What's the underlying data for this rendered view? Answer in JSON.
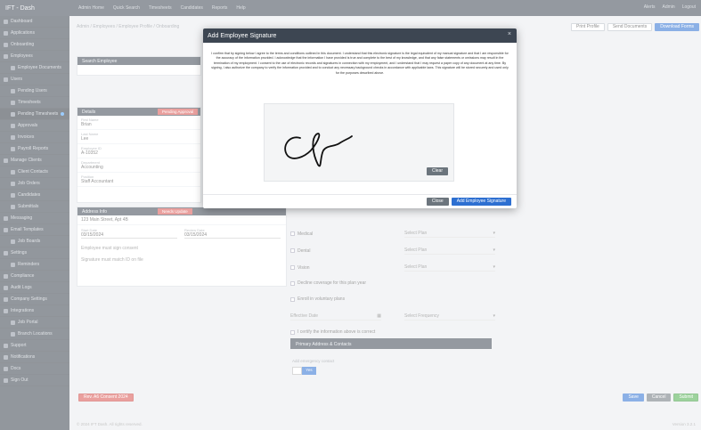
{
  "topbar": {
    "brand": "IFT - Dash",
    "links": [
      "Admin Home",
      "Quick Search",
      "Timesheets",
      "Candidates",
      "Reports",
      "Help"
    ],
    "right": [
      "Alerts",
      "Admin",
      "Logout"
    ]
  },
  "sidebar": {
    "items": [
      {
        "label": "Dashboard",
        "active": false,
        "sub": false
      },
      {
        "label": "Applications",
        "active": false,
        "sub": false
      },
      {
        "label": "Onboarding",
        "active": false,
        "sub": false
      },
      {
        "label": "Employees",
        "active": false,
        "sub": false
      },
      {
        "label": "Employee Documents",
        "active": false,
        "sub": true
      },
      {
        "label": "Users",
        "active": false,
        "sub": false
      },
      {
        "label": "Pending Users",
        "active": false,
        "sub": true
      },
      {
        "label": "Timesheets",
        "active": false,
        "sub": true
      },
      {
        "label": "Pending Timesheets",
        "active": true,
        "sub": true,
        "dot": true
      },
      {
        "label": "Approvals",
        "active": false,
        "sub": true
      },
      {
        "label": "Invoices",
        "active": false,
        "sub": true
      },
      {
        "label": "Payroll Reports",
        "active": false,
        "sub": true
      },
      {
        "label": "Manage Clients",
        "active": false,
        "sub": false
      },
      {
        "label": "Client Contacts",
        "active": false,
        "sub": true
      },
      {
        "label": "Job Orders",
        "active": false,
        "sub": true
      },
      {
        "label": "Candidates",
        "active": false,
        "sub": true
      },
      {
        "label": "Submittals",
        "active": false,
        "sub": true
      },
      {
        "label": "Messaging",
        "active": false,
        "sub": false
      },
      {
        "label": "Email Templates",
        "active": false,
        "sub": false
      },
      {
        "label": "Job Boards",
        "active": false,
        "sub": true
      },
      {
        "label": "Settings",
        "active": false,
        "sub": false
      },
      {
        "label": "Reminders",
        "active": false,
        "sub": true
      },
      {
        "label": "Compliance",
        "active": false,
        "sub": false
      },
      {
        "label": "Audit Logs",
        "active": false,
        "sub": false
      },
      {
        "label": "Company Settings",
        "active": false,
        "sub": false
      },
      {
        "label": "Integrations",
        "active": false,
        "sub": false
      },
      {
        "label": "Job Portal",
        "active": false,
        "sub": true
      },
      {
        "label": "Branch Locations",
        "active": false,
        "sub": true
      },
      {
        "label": "Support",
        "active": false,
        "sub": false
      },
      {
        "label": "Notifications",
        "active": false,
        "sub": false
      },
      {
        "label": "Docs",
        "active": false,
        "sub": false
      },
      {
        "label": "Sign Out",
        "active": false,
        "sub": false
      }
    ]
  },
  "main": {
    "breadcrumb": "Admin / Employees / Employee Profile / Onboarding",
    "top_buttons": [
      "Print Profile",
      "Send Documents",
      "Download Forms"
    ],
    "left_panel": {
      "search_label": "Search Employee",
      "header": "Details",
      "tag": "Pending Approval",
      "fields": [
        {
          "label": "First Name",
          "value": "Brian"
        },
        {
          "label": "Last Name",
          "value": "Lee"
        },
        {
          "label": "Employee ID",
          "value": "A-10352"
        },
        {
          "label": "Department",
          "value": "Accounting"
        },
        {
          "label": "Position",
          "value": "Staff Accountant"
        }
      ]
    },
    "address_panel": {
      "header": "Address Info",
      "tag": "Needs Update",
      "street": "123 Main Street, Apt 4B",
      "start_label": "Start Date",
      "start_date": "03/15/2024",
      "review_label": "Review Date",
      "review_date": "03/15/2024",
      "note1": "Employee must sign consent",
      "note2": "Signature must match ID on file"
    },
    "right_panel": {
      "header": "Benefits Enrollment",
      "rows": [
        {
          "check": "Medical",
          "select": "Select Plan"
        },
        {
          "check": "Dental",
          "select": "Select Plan"
        },
        {
          "check": "Vision",
          "select": "Select Plan"
        }
      ],
      "check4": "Decline coverage for this plan year",
      "check5": "Enroll in voluntary plans",
      "date_placeholder": "Effective Date",
      "select4": "Select Frequency",
      "check6": "I certify the information above is correct",
      "bottom_header": "Primary Address & Contacts",
      "bottom_label": "Add emergency contact",
      "bottom_select": "Yes"
    },
    "red_button": "Rev. A6 Consent 2024",
    "bottom_buttons": [
      "Save",
      "Cancel",
      "Submit"
    ],
    "footer": "© 2024 IFT Dash. All rights reserved.",
    "footer_right": "Version 3.2.1"
  },
  "modal": {
    "title": "Add Employee Signature",
    "close": "×",
    "consent_text": "I confirm that by signing below I agree to the terms and conditions outlined in this document. I understand that this electronic signature is the legal equivalent of my manual signature and that I am responsible for the accuracy of the information provided. I acknowledge that the information I have provided is true and complete to the best of my knowledge, and that any false statements or omissions may result in the termination of my employment. I consent to the use of electronic records and signatures in connection with my employment, and I understand that I may request a paper copy of any document at any time. By signing, I also authorize the company to verify the information provided and to conduct any necessary background checks in accordance with applicable laws. This signature will be stored securely and used only for the purposes described above.",
    "clear_label": "Clear",
    "cancel_label": "Close",
    "save_label": "Add Employee Signature"
  },
  "colors": {
    "topbar": "#3d4652",
    "sidebar": "#3a424d",
    "accent_blue": "#2d6fd1",
    "danger": "#d9534f",
    "success": "#4cae4c"
  }
}
